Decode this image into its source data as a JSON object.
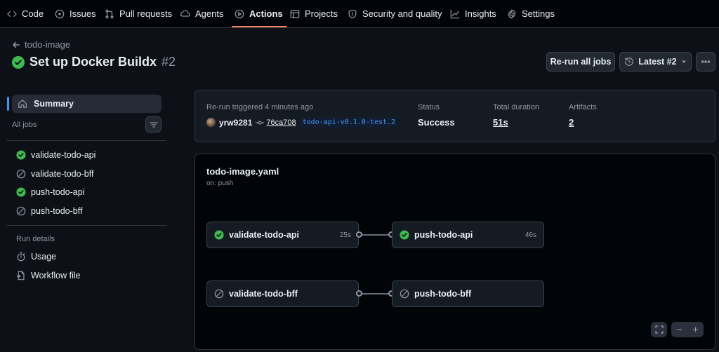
{
  "nav": {
    "tabs": [
      {
        "label": "Code",
        "icon": "code-icon"
      },
      {
        "label": "Issues",
        "icon": "issue-icon"
      },
      {
        "label": "Pull requests",
        "icon": "pull-request-icon"
      },
      {
        "label": "Agents",
        "icon": "agent-icon"
      },
      {
        "label": "Actions",
        "icon": "play-icon",
        "active": true
      },
      {
        "label": "Projects",
        "icon": "table-icon"
      },
      {
        "label": "Security and quality",
        "icon": "shield-icon"
      },
      {
        "label": "Insights",
        "icon": "graph-icon"
      },
      {
        "label": "Settings",
        "icon": "gear-icon"
      }
    ]
  },
  "header": {
    "back_label": "todo-image",
    "title": "Set up Docker Buildx",
    "run_number": "#2",
    "rerun_label": "Re-run all jobs",
    "latest_label": "Latest #2"
  },
  "sidebar": {
    "summary_label": "Summary",
    "all_jobs_label": "All jobs",
    "jobs": [
      {
        "label": "validate-todo-api",
        "status": "success"
      },
      {
        "label": "validate-todo-bff",
        "status": "skipped"
      },
      {
        "label": "push-todo-api",
        "status": "success"
      },
      {
        "label": "push-todo-bff",
        "status": "skipped"
      }
    ],
    "run_details_label": "Run details",
    "details": [
      {
        "label": "Usage",
        "icon": "stopwatch-icon"
      },
      {
        "label": "Workflow file",
        "icon": "file-icon"
      }
    ]
  },
  "summary": {
    "trigger_text": "Re-run triggered 4 minutes ago",
    "user": "yrw9281",
    "commit": "76ca708",
    "tag": "todo-api-v0.1.0-test.2",
    "status_label": "Status",
    "status_value": "Success",
    "duration_label": "Total duration",
    "duration_value": "51s",
    "artifacts_label": "Artifacts",
    "artifacts_value": "2"
  },
  "workflow": {
    "file": "todo-image.yaml",
    "trigger": "on: push",
    "jobs": [
      {
        "label": "validate-todo-api",
        "status": "success",
        "duration": "25s"
      },
      {
        "label": "push-todo-api",
        "status": "success",
        "duration": "46s"
      },
      {
        "label": "validate-todo-bff",
        "status": "skipped",
        "duration": ""
      },
      {
        "label": "push-todo-bff",
        "status": "skipped",
        "duration": ""
      }
    ]
  },
  "colors": {
    "success": "#3fb950",
    "accent": "#f78166",
    "link": "#4493f8"
  }
}
